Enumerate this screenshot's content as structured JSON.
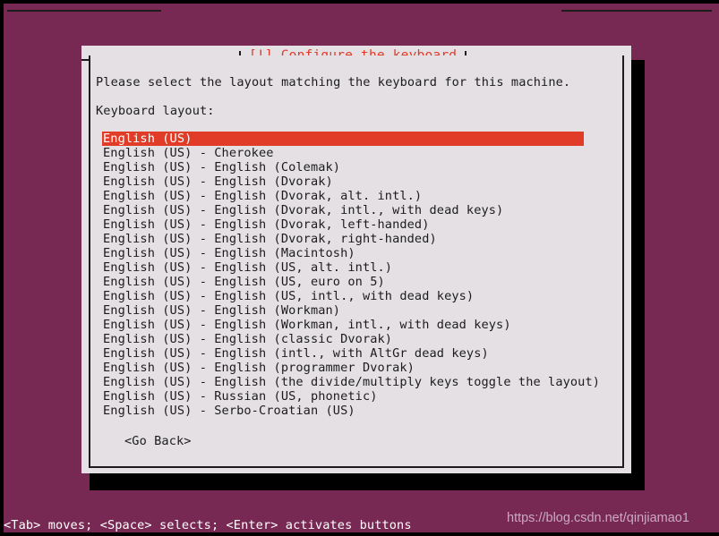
{
  "screen": {
    "background_color": "#772953",
    "accent_color": "#e03c28",
    "panel_color": "#e4e0e4"
  },
  "dialog": {
    "title": "[!] Configure the keyboard",
    "prompt": "Please select the layout matching the keyboard for this machine.",
    "field_label": "Keyboard layout:",
    "go_back_label": "<Go Back>",
    "selected_index": 0,
    "options": [
      "English (US)",
      "English (US) - Cherokee",
      "English (US) - English (Colemak)",
      "English (US) - English (Dvorak)",
      "English (US) - English (Dvorak, alt. intl.)",
      "English (US) - English (Dvorak, intl., with dead keys)",
      "English (US) - English (Dvorak, left-handed)",
      "English (US) - English (Dvorak, right-handed)",
      "English (US) - English (Macintosh)",
      "English (US) - English (US, alt. intl.)",
      "English (US) - English (US, euro on 5)",
      "English (US) - English (US, intl., with dead keys)",
      "English (US) - English (Workman)",
      "English (US) - English (Workman, intl., with dead keys)",
      "English (US) - English (classic Dvorak)",
      "English (US) - English (intl., with AltGr dead keys)",
      "English (US) - English (programmer Dvorak)",
      "English (US) - English (the divide/multiply keys toggle the layout)",
      "English (US) - Russian (US, phonetic)",
      "English (US) - Serbo-Croatian (US)"
    ]
  },
  "status_bar": {
    "hint": "<Tab> moves; <Space> selects; <Enter> activates buttons"
  },
  "watermark": {
    "text": "https://blog.csdn.net/qinjiamao1"
  }
}
